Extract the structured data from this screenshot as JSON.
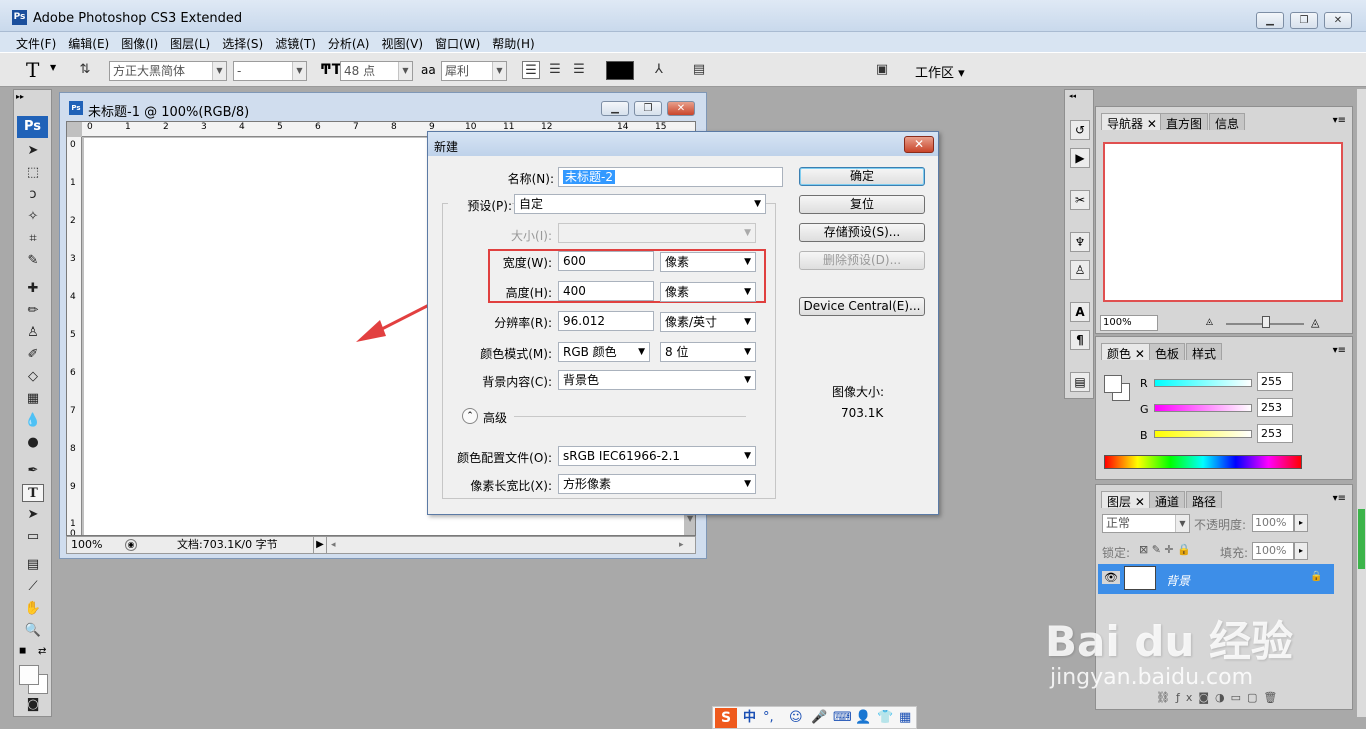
{
  "window": {
    "logo": "Ps",
    "title": "Adobe Photoshop CS3 Extended",
    "controls": [
      "minimize-icon",
      "restore-icon",
      "close-icon"
    ]
  },
  "menu": [
    "文件(F)",
    "编辑(E)",
    "图像(I)",
    "图层(L)",
    "选择(S)",
    "滤镜(T)",
    "分析(A)",
    "视图(V)",
    "窗口(W)",
    "帮助(H)"
  ],
  "options": {
    "tool_glyph": "T",
    "font_family": "方正大黑简体",
    "font_style": "-",
    "font_size": "48 点",
    "aa_label": "aa",
    "antialias": "犀利",
    "workspace": "工作区"
  },
  "toolbox": {
    "badge": "Ps"
  },
  "document": {
    "title": "未标题-1 @ 100%(RGB/8)",
    "ps_badge": "Ps",
    "zoom": "100%",
    "doc_info": "文档:703.1K/0 字节",
    "ruler_top": [
      "0",
      "1",
      "2",
      "3",
      "4",
      "5",
      "6",
      "7",
      "8",
      "9",
      "10",
      "11",
      "12",
      "14",
      "15"
    ],
    "ruler_left": [
      "0",
      "1",
      "2",
      "3",
      "4",
      "5",
      "6",
      "7",
      "8",
      "9",
      "1 0"
    ]
  },
  "dialog": {
    "title": "新建",
    "name_label": "名称(N):",
    "name_value": "未标题-2",
    "preset_label": "预设(P):",
    "preset_value": "自定",
    "size_label": "大小(I):",
    "width_label": "宽度(W):",
    "width_value": "600",
    "width_unit": "像素",
    "height_label": "高度(H):",
    "height_value": "400",
    "height_unit": "像素",
    "resolution_label": "分辨率(R):",
    "resolution_value": "96.012",
    "resolution_unit": "像素/英寸",
    "color_mode_label": "颜色模式(M):",
    "color_mode_value": "RGB 颜色",
    "bit_depth": "8 位",
    "bg_label": "背景内容(C):",
    "bg_value": "背景色",
    "advanced_label": "高级",
    "profile_label": "颜色配置文件(O):",
    "profile_value": "sRGB IEC61966-2.1",
    "aspect_label": "像素长宽比(X):",
    "aspect_value": "方形像素",
    "buttons": {
      "ok": "确定",
      "reset": "复位",
      "save_preset": "存储预设(S)...",
      "delete_preset": "删除预设(D)...",
      "device_central": "Device Central(E)..."
    },
    "image_size_label": "图像大小:",
    "image_size_value": "703.1K",
    "highlight_color": "#e0403f"
  },
  "panels": {
    "navigator": {
      "tabs": [
        "导航器",
        "直方图",
        "信息"
      ],
      "zoom": "100%",
      "proxy_color": "#e05050"
    },
    "color": {
      "tabs": [
        "颜色",
        "色板",
        "样式"
      ],
      "channels": [
        {
          "label": "R",
          "value": "255"
        },
        {
          "label": "G",
          "value": "253"
        },
        {
          "label": "B",
          "value": "253"
        }
      ]
    },
    "layers": {
      "tabs": [
        "图层",
        "通道",
        "路径"
      ],
      "blend_mode": "正常",
      "opacity_label": "不透明度:",
      "opacity": "100%",
      "lock_label": "锁定:",
      "fill_label": "填充:",
      "fill": "100%",
      "layer_name": "背景"
    }
  },
  "taskbar": {
    "ime_items": [
      "中",
      "°,"
    ]
  },
  "watermark": {
    "text": "Bai du 经验",
    "url": "jingyan.baidu.com"
  }
}
